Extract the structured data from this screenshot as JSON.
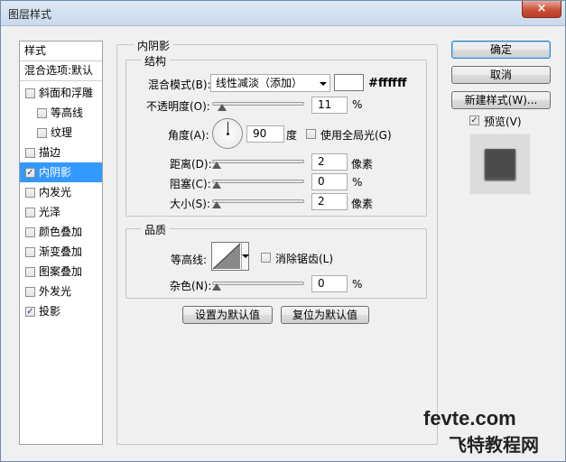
{
  "window": {
    "title": "图层样式",
    "close_label": "×"
  },
  "sidebar": {
    "header_style": "样式",
    "header_blend": "混合选项:默认",
    "items": [
      {
        "label": "斜面和浮雕",
        "checked": false,
        "indent": false,
        "selected": false
      },
      {
        "label": "等高线",
        "checked": false,
        "indent": true,
        "selected": false
      },
      {
        "label": "纹理",
        "checked": false,
        "indent": true,
        "selected": false
      },
      {
        "label": "描边",
        "checked": false,
        "indent": false,
        "selected": false
      },
      {
        "label": "内阴影",
        "checked": true,
        "indent": false,
        "selected": true
      },
      {
        "label": "内发光",
        "checked": false,
        "indent": false,
        "selected": false
      },
      {
        "label": "光泽",
        "checked": false,
        "indent": false,
        "selected": false
      },
      {
        "label": "颜色叠加",
        "checked": false,
        "indent": false,
        "selected": false
      },
      {
        "label": "渐变叠加",
        "checked": false,
        "indent": false,
        "selected": false
      },
      {
        "label": "图案叠加",
        "checked": false,
        "indent": false,
        "selected": false
      },
      {
        "label": "外发光",
        "checked": false,
        "indent": false,
        "selected": false
      },
      {
        "label": "投影",
        "checked": true,
        "indent": false,
        "selected": false
      }
    ]
  },
  "panel": {
    "title": "内阴影",
    "structure": {
      "label": "结构",
      "blend_mode_label": "混合模式(B):",
      "blend_mode_value": "线性减淡（添加）",
      "color_value": "#ffffff",
      "color_swatch": "#ffffff",
      "opacity_label": "不透明度(O):",
      "opacity_value": "11",
      "opacity_unit": "%",
      "angle_label": "角度(A):",
      "angle_value": "90",
      "angle_unit": "度",
      "global_light_label": "使用全局光(G)",
      "global_light_checked": false,
      "distance_label": "距离(D):",
      "distance_value": "2",
      "distance_unit": "像素",
      "choke_label": "阻塞(C):",
      "choke_value": "0",
      "choke_unit": "%",
      "size_label": "大小(S):",
      "size_value": "2",
      "size_unit": "像素"
    },
    "quality": {
      "label": "品质",
      "contour_label": "等高线:",
      "antialias_label": "消除锯齿(L)",
      "antialias_checked": false,
      "noise_label": "杂色(N):",
      "noise_value": "0",
      "noise_unit": "%"
    },
    "set_default_label": "设置为默认值",
    "reset_default_label": "复位为默认值"
  },
  "actions": {
    "ok_label": "确定",
    "cancel_label": "取消",
    "new_style_label": "新建样式(W)...",
    "preview_label": "预览(V)",
    "preview_checked": true
  },
  "watermark": {
    "line1": "fevte.com",
    "line2": "飞特教程网"
  },
  "colors": {
    "selection": "#3399ff",
    "preview_fill": "#4a4a4a"
  }
}
